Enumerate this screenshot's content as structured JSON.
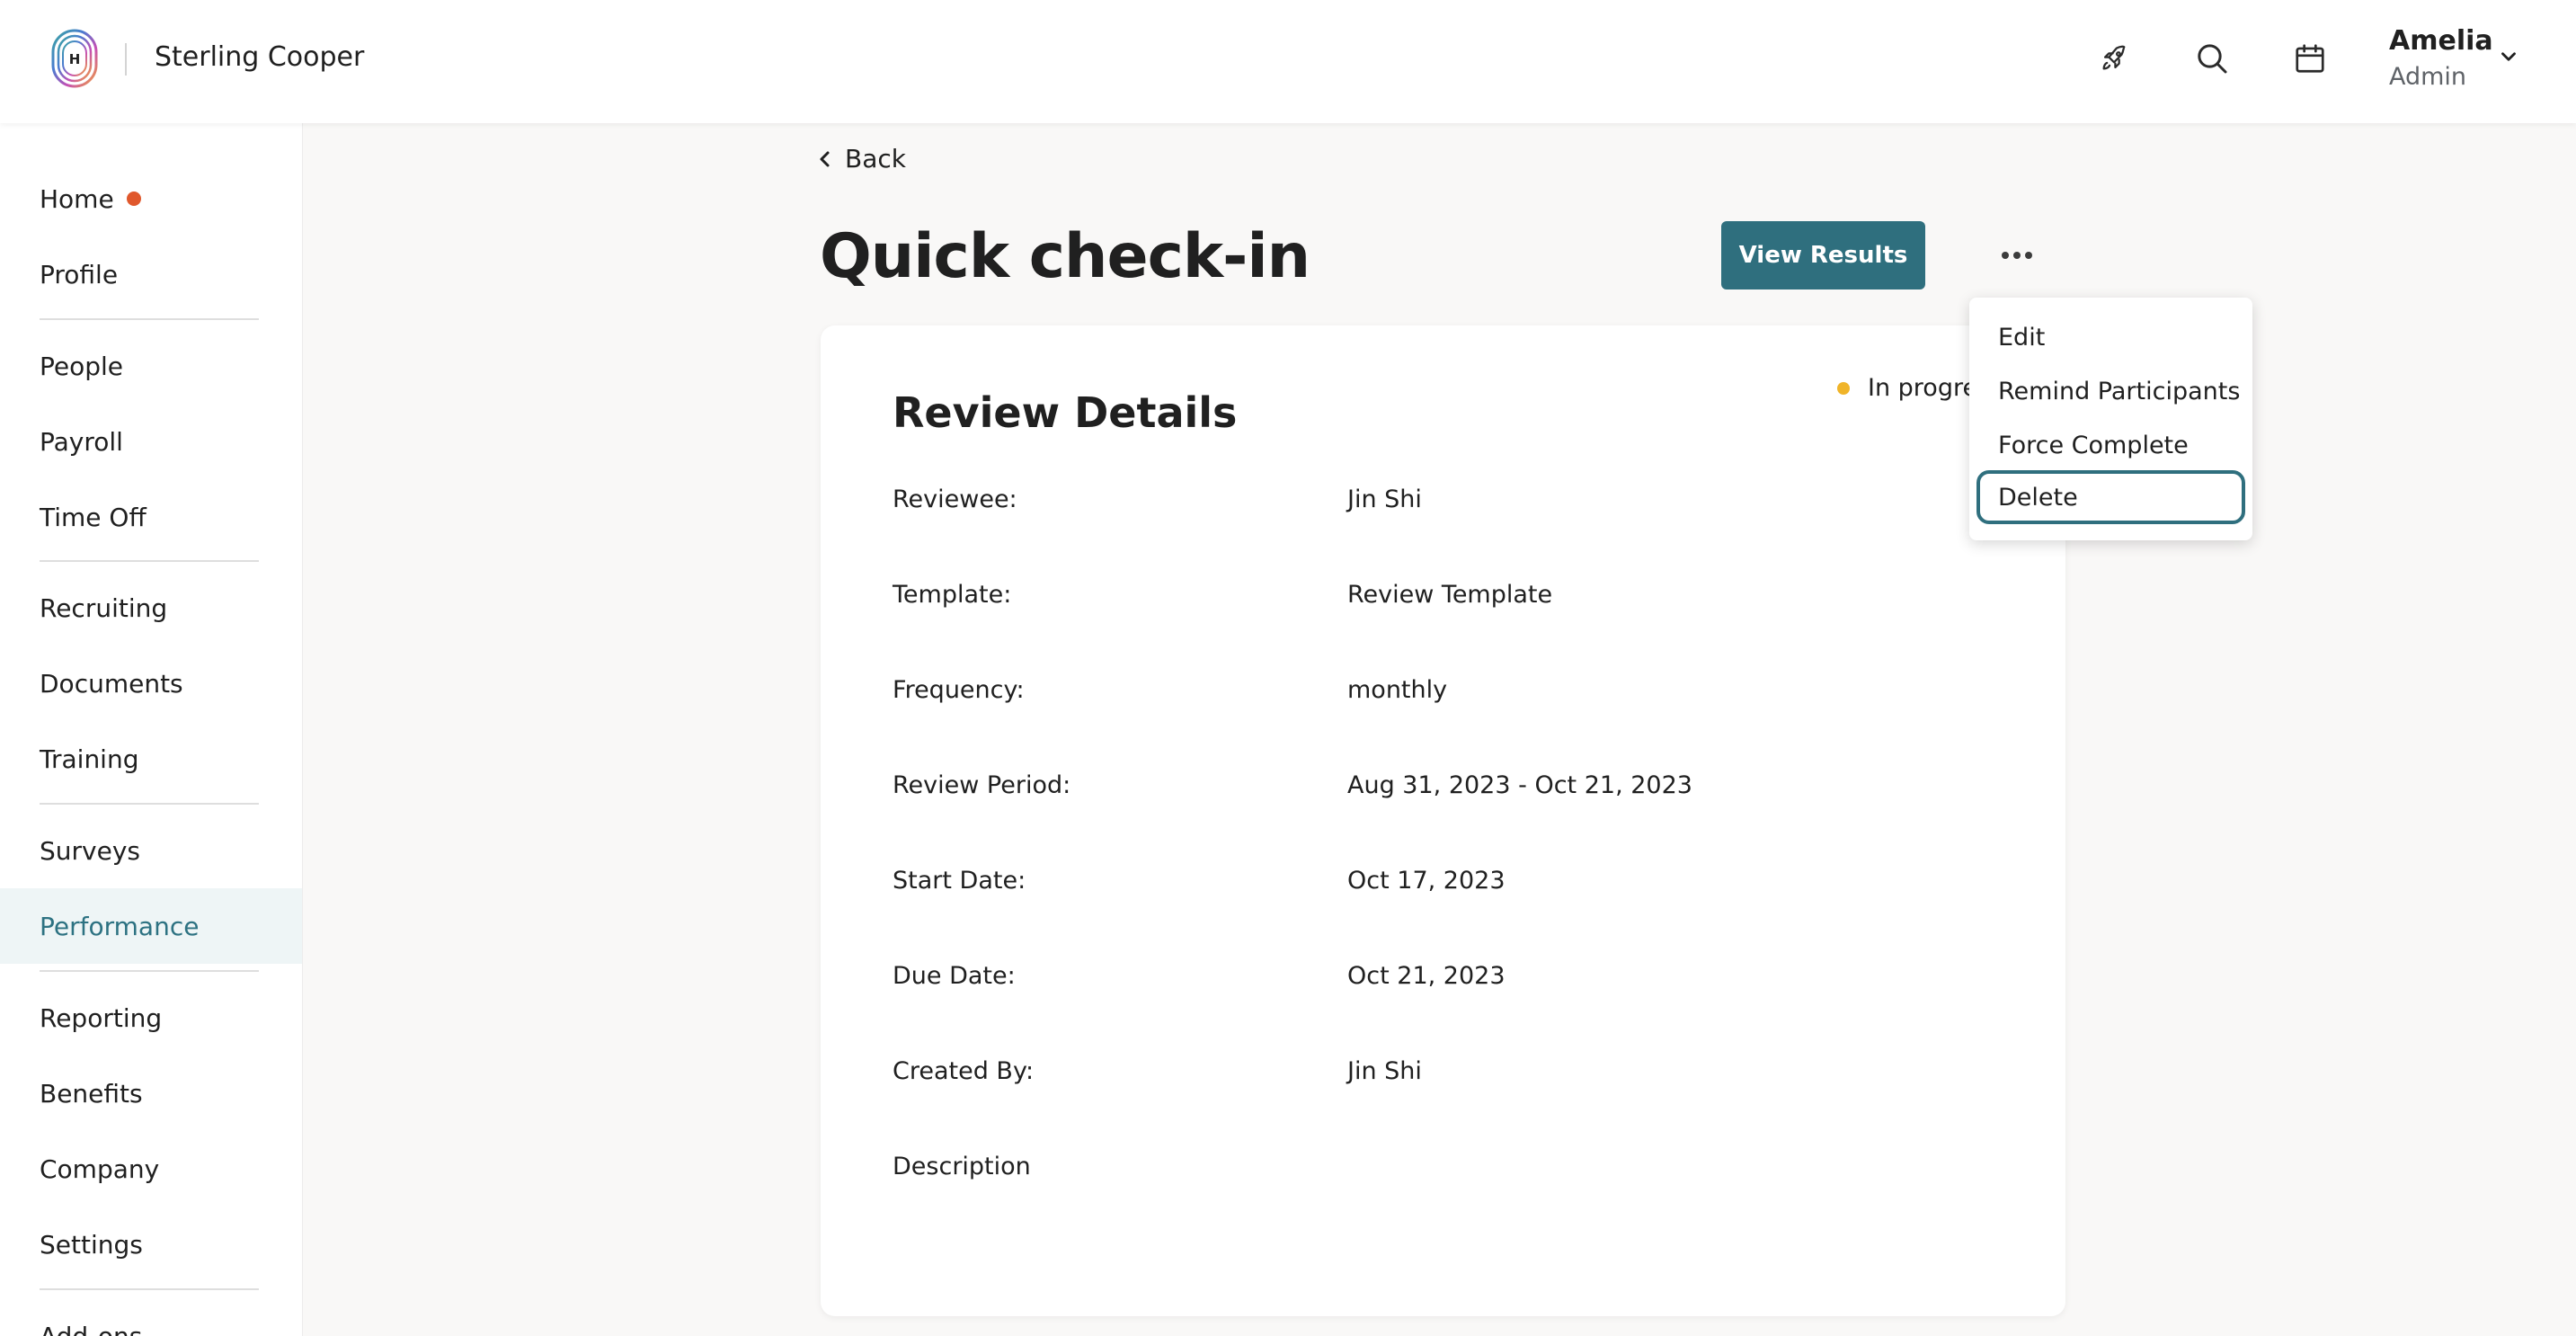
{
  "header": {
    "company": "Sterling Cooper",
    "logo_letter": "H",
    "icons": [
      "rocket-icon",
      "search-icon",
      "calendar-icon",
      "chevron-down-icon"
    ],
    "user": {
      "name": "Amelia",
      "role": "Admin"
    }
  },
  "sidebar": {
    "items": [
      {
        "label": "Home",
        "has_notification": true
      },
      {
        "label": "Profile"
      },
      {
        "label": "People"
      },
      {
        "label": "Payroll"
      },
      {
        "label": "Time Off"
      },
      {
        "label": "Recruiting"
      },
      {
        "label": "Documents"
      },
      {
        "label": "Training"
      },
      {
        "label": "Surveys"
      },
      {
        "label": "Performance",
        "active": true
      },
      {
        "label": "Reporting"
      },
      {
        "label": "Benefits"
      },
      {
        "label": "Company"
      },
      {
        "label": "Settings"
      },
      {
        "label": "Add-ons"
      }
    ]
  },
  "page": {
    "back_label": "Back",
    "title": "Quick check-in",
    "view_results_label": "View Results"
  },
  "review": {
    "title": "Review Details",
    "status": "In progress",
    "rows": [
      {
        "label": "Reviewee:",
        "value": "Jin Shi"
      },
      {
        "label": "Template:",
        "value": "Review Template"
      },
      {
        "label": "Frequency:",
        "value": "monthly"
      },
      {
        "label": "Review Period:",
        "value": "Aug 31, 2023 - Oct 21, 2023"
      },
      {
        "label": "Start Date:",
        "value": "Oct 17, 2023"
      },
      {
        "label": "Due Date:",
        "value": "Oct 21, 2023"
      },
      {
        "label": "Created By:",
        "value": "Jin Shi"
      },
      {
        "label": "Description",
        "value": ""
      }
    ]
  },
  "menu": {
    "items": [
      {
        "label": "Edit"
      },
      {
        "label": "Remind Participants"
      },
      {
        "label": "Force Complete"
      },
      {
        "label": "Delete",
        "focused": true
      }
    ]
  },
  "colors": {
    "primary": "#2f6f7e",
    "active_nav_text": "#2d7282",
    "active_nav_bg": "#eef5f6",
    "notification_dot": "#e0582c",
    "status_dot": "#f0b429"
  }
}
